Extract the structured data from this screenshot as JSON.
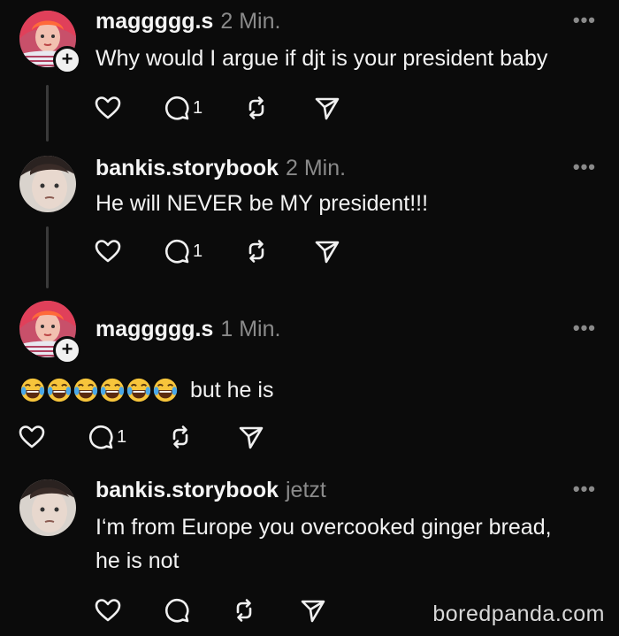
{
  "posts": [
    {
      "username": "maggggg.s",
      "time": "2 Min.",
      "text": "Why would I argue if djt is your president baby",
      "reply_count": "1",
      "has_plus": true
    },
    {
      "username": "bankis.storybook",
      "time": "2 Min.",
      "text": "He will NEVER be MY president!!!",
      "reply_count": "1",
      "has_plus": false
    },
    {
      "username": "maggggg.s",
      "time": "1 Min.",
      "text": "but he is",
      "emoji": "😂😂😂😂😂😂",
      "reply_count": "1",
      "has_plus": true
    },
    {
      "username": "bankis.storybook",
      "time": "jetzt",
      "text_line1": "I‘m from Europe you overcooked ginger bread,",
      "text_line2": "he is not",
      "reply_count": "",
      "has_plus": false
    }
  ],
  "more_label": "•••",
  "plus_label": "+",
  "watermark": "boredpanda.com",
  "icons": {
    "like": "heart-icon",
    "reply": "comment-icon",
    "repost": "repost-icon",
    "share": "send-icon",
    "more": "more-icon"
  },
  "colors": {
    "background": "#0b0b0b",
    "text": "#f3f3f3",
    "muted": "#8a8a8a",
    "thread_line": "#3a3a3a"
  }
}
